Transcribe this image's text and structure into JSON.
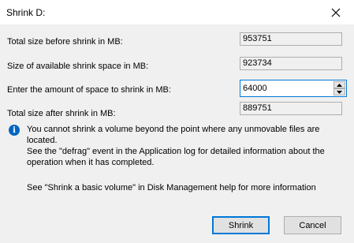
{
  "window": {
    "title": "Shrink D:",
    "close_icon": "close-icon"
  },
  "fields": {
    "total_size_before": {
      "label": "Total size before shrink in MB:",
      "value": "953751"
    },
    "available_shrink": {
      "label": "Size of available shrink space in MB:",
      "value": "923734"
    },
    "amount_to_shrink": {
      "label": "Enter the amount of space to shrink in MB:",
      "value": "64000"
    },
    "total_size_after": {
      "label": "Total size after shrink in MB:",
      "value": "889751"
    }
  },
  "info": {
    "icon": "info-icon",
    "line1": "You cannot shrink a volume beyond the point where any unmovable files are located.",
    "line2": "See the \"defrag\" event in the Application log for detailed information about the",
    "line3": "operation when it has completed."
  },
  "help_text": "See \"Shrink a basic volume\" in Disk Management help for more information",
  "buttons": {
    "shrink": "Shrink",
    "cancel": "Cancel"
  }
}
